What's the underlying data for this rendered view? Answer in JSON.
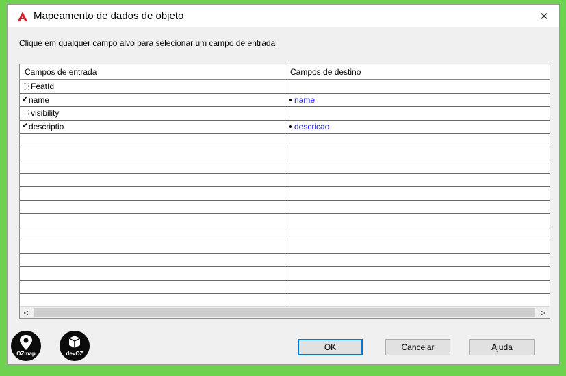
{
  "window": {
    "title": "Mapeamento de dados de objeto",
    "close_symbol": "✕"
  },
  "instructions": "Clique em qualquer campo alvo para selecionar um campo de entrada",
  "grid": {
    "headers": [
      "Campos de entrada",
      "Campos de destino"
    ],
    "rows": [
      {
        "input": "FeatId",
        "checked": false,
        "target": ""
      },
      {
        "input": "name",
        "checked": true,
        "target": "name"
      },
      {
        "input": "visibility",
        "checked": false,
        "target": ""
      },
      {
        "input": "descriptio",
        "checked": true,
        "target": "descricao"
      }
    ],
    "check_mark": "✔"
  },
  "scrollbar": {
    "left_arrow": "<",
    "right_arrow": ">"
  },
  "buttons": {
    "ok": "OK",
    "cancel": "Cancelar",
    "help": "Ajuda"
  },
  "logos": {
    "ozmap": "OZmap",
    "devoz": "devOZ"
  },
  "colors": {
    "target_text": "#1a1aff",
    "accent_border": "#0078d7",
    "background": "#6fd24e",
    "app_icon": "#d0202a"
  }
}
